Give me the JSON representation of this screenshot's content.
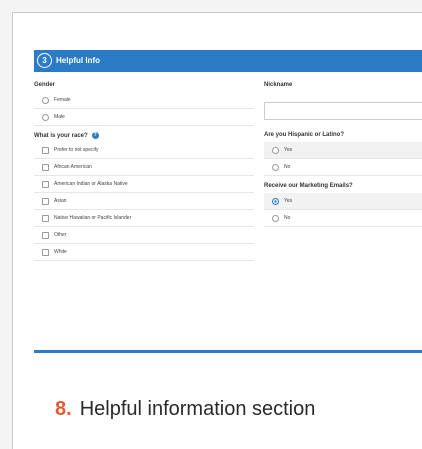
{
  "section": {
    "step_number": "3",
    "title": "Helpful Info"
  },
  "gender": {
    "label": "Gender",
    "options": [
      "Female",
      "Male"
    ]
  },
  "nickname": {
    "label": "Nickname",
    "value": ""
  },
  "race": {
    "label": "What is your race?",
    "options": [
      "Prefer to not specify",
      "African American",
      "American Indian or Alaska Native",
      "Asian",
      "Native Hawaiian or Pacific Islander",
      "Other",
      "White"
    ]
  },
  "hispanic": {
    "label": "Are you Hispanic or Latino?",
    "options": [
      "Yes",
      "No"
    ]
  },
  "marketing": {
    "label": "Receive our Marketing Emails?",
    "options": [
      "Yes",
      "No"
    ],
    "selected": "Yes"
  },
  "caption": {
    "number": "8.",
    "text": "Helpful information section"
  },
  "colors": {
    "accent": "#2b7cc4",
    "caption_number": "#e15b34"
  }
}
